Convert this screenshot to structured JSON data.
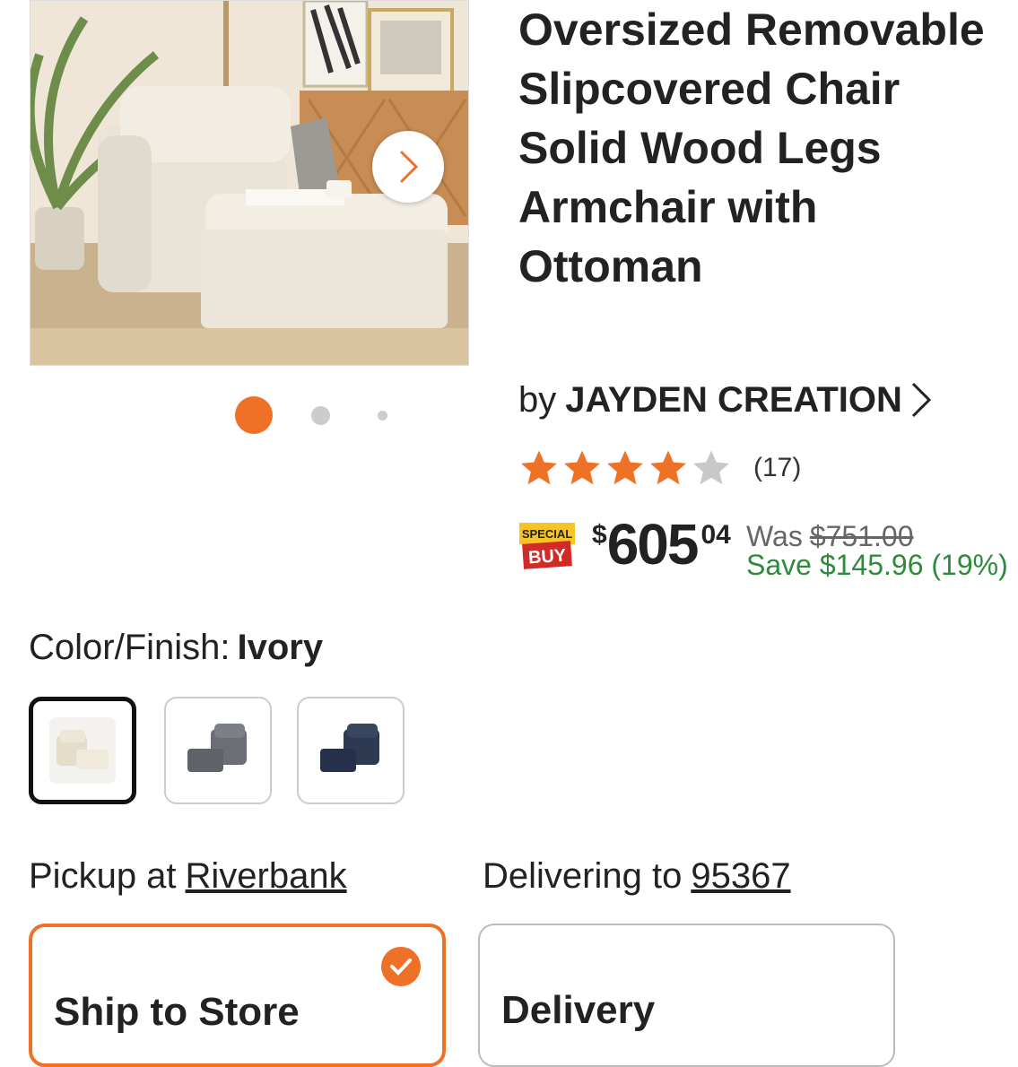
{
  "product": {
    "title": "Oversized Removable Slipcovered Chair Solid Wood Legs Armchair with Ottoman",
    "brand_prefix": "by",
    "brand": "JAYDEN CREATION",
    "rating": 4,
    "rating_max": 5,
    "review_count": "(17)"
  },
  "gallery": {
    "image_icon": "armchair-with-ottoman-photo",
    "active_index": 0,
    "dot_count": 3
  },
  "price": {
    "badge_top": "SPECIAL",
    "badge_bottom": "BUY",
    "currency": "$",
    "dollars": "605",
    "cents": "04",
    "was_label": "Was",
    "was_price": "$751.00",
    "save_text": "Save $145.96 (19%)"
  },
  "color": {
    "label": "Color/Finish:",
    "selected": "Ivory",
    "swatches": [
      "ivory-chair-swatch",
      "gray-chair-swatch",
      "navy-chair-swatch"
    ]
  },
  "fulfillment": {
    "pickup_label": "Pickup at",
    "pickup_store": "Riverbank",
    "deliver_label": "Delivering to",
    "deliver_zip": "95367",
    "option_ship": "Ship to Store",
    "option_delivery": "Delivery"
  },
  "colors": {
    "accent": "#ee7127",
    "save_green": "#2f8a3b",
    "star_empty": "#c8c8c8"
  }
}
